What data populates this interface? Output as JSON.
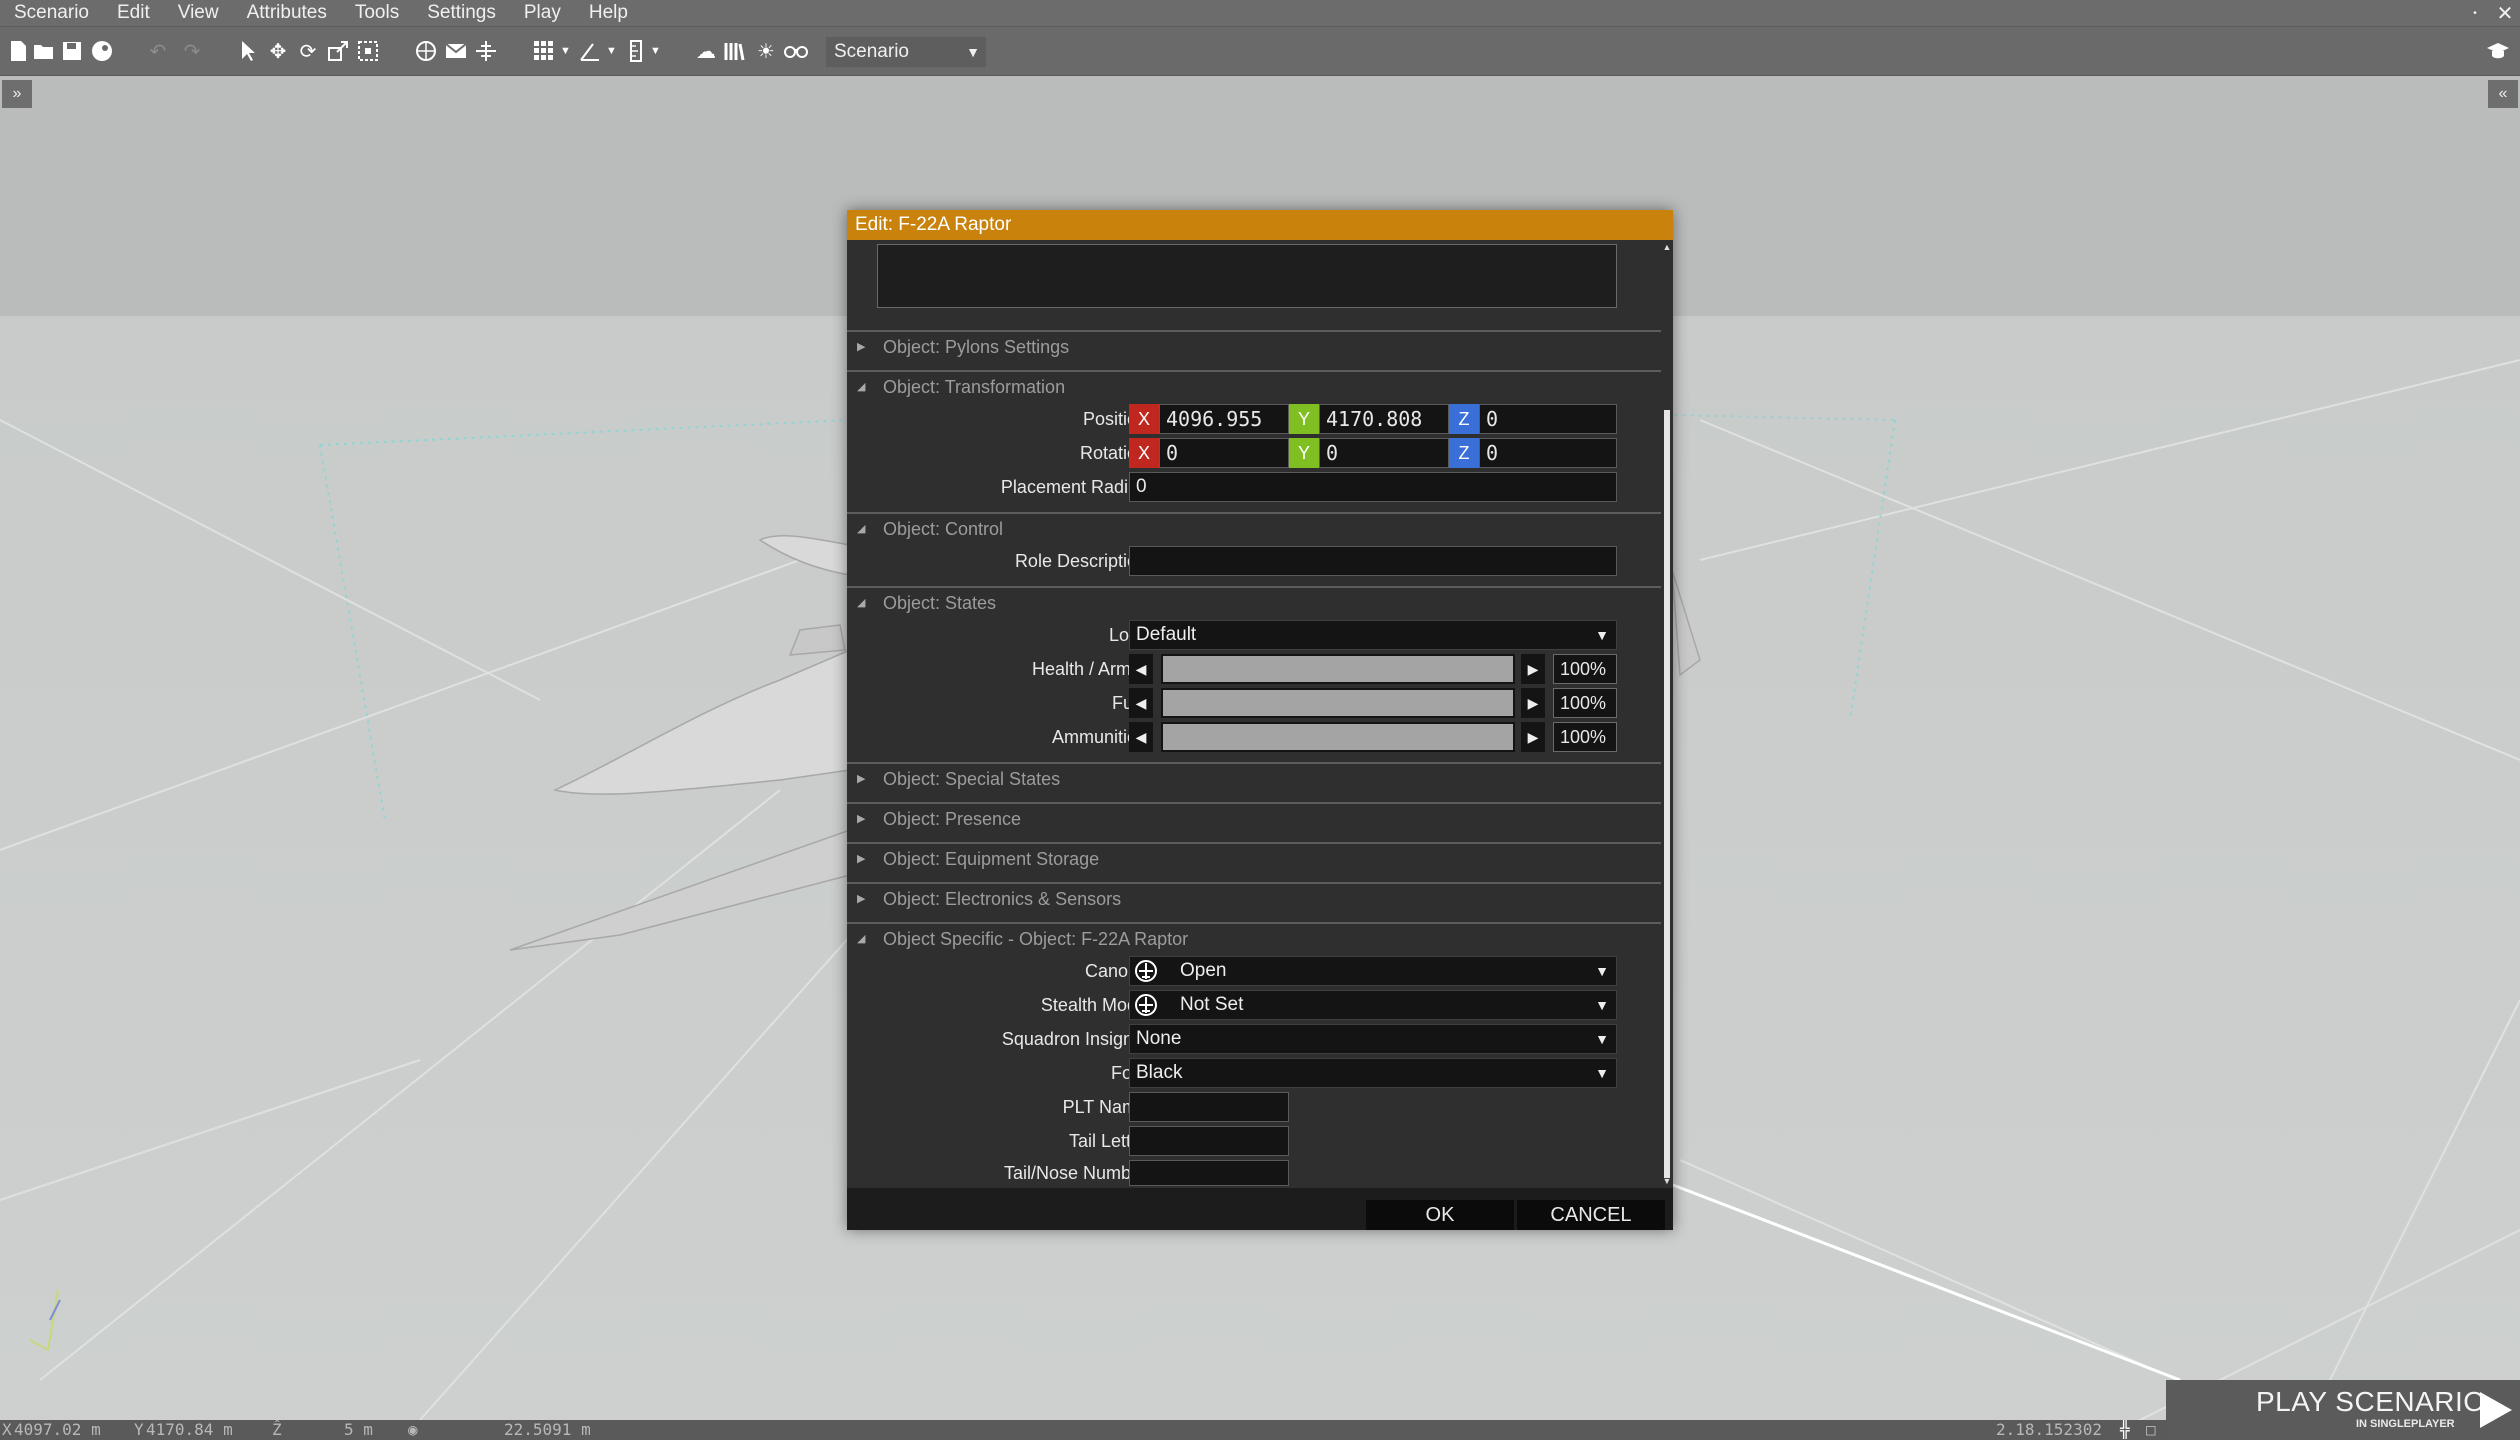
{
  "menu": [
    "Scenario",
    "Edit",
    "View",
    "Attributes",
    "Tools",
    "Settings",
    "Play",
    "Help"
  ],
  "toolbar": {
    "mode_select": "Scenario"
  },
  "dialog": {
    "title": "Edit: F-22A Raptor",
    "sections": {
      "pylons": "Object: Pylons Settings",
      "transformation": "Object: Transformation",
      "control": "Object: Control",
      "states": "Object: States",
      "special_states": "Object: Special States",
      "presence": "Object: Presence",
      "equipment": "Object: Equipment Storage",
      "electronics": "Object: Electronics & Sensors",
      "specific": "Object Specific - Object: F-22A Raptor"
    },
    "transformation": {
      "position_label": "Position",
      "rotation_label": "Rotation",
      "radius_label": "Placement Radius",
      "axis_x": "X",
      "axis_y": "Y",
      "axis_z": "Z",
      "position": {
        "x": "4096.955",
        "y": "4170.808",
        "z": "0"
      },
      "rotation": {
        "x": "0",
        "y": "0",
        "z": "0"
      },
      "radius": "0"
    },
    "control": {
      "role_label": "Role Description",
      "role_value": ""
    },
    "states": {
      "lock_label": "Lock",
      "lock_value": "Default",
      "health_label": "Health / Armor",
      "health_value": "100%",
      "health_fraction": 1.0,
      "fuel_label": "Fuel",
      "fuel_value": "100%",
      "fuel_fraction": 1.0,
      "ammo_label": "Ammunition",
      "ammo_value": "100%",
      "ammo_fraction": 1.0
    },
    "specific": {
      "canopy_label": "Canopy",
      "canopy_value": "Open",
      "stealth_label": "Stealth Mode",
      "stealth_value": "Not Set",
      "insignia_label": "Squadron Insignia",
      "insignia_value": "None",
      "font_label": "Font",
      "font_value": "Black",
      "plt_label": "PLT Name",
      "plt_value": "",
      "tail_letter_label": "Tail Letter",
      "tail_letter_value": "",
      "tail_number_label": "Tail/Nose Number",
      "tail_number_value": ""
    },
    "ok_label": "OK",
    "cancel_label": "CANCEL"
  },
  "statusbar": {
    "x_coord": "4097.02 m",
    "y_coord": "4170.84 m",
    "z_value": "5 m",
    "view_distance": "22.5091 m",
    "version": "2.18.152302",
    "play_label": "PLAY SCENARIO",
    "play_sub": "IN SINGLEPLAYER"
  },
  "colors": {
    "title_bar": "#c9820b",
    "axis_x": "#c0271f",
    "axis_y": "#7fbf22",
    "axis_z": "#3a6fd8"
  },
  "icons": [
    "new-file-icon",
    "open-folder-icon",
    "save-icon",
    "steam-icon",
    "undo-icon",
    "redo-icon",
    "select-icon",
    "move-icon",
    "rotate-icon",
    "scale-icon",
    "box-select-icon",
    "globe-icon",
    "mail-icon",
    "vertical-snap-icon",
    "grid-icon",
    "angle-icon",
    "ruler-icon",
    "weather-icon",
    "library-icon",
    "sun-icon",
    "binoculars-icon",
    "graduation-cap-icon",
    "close-icon"
  ]
}
